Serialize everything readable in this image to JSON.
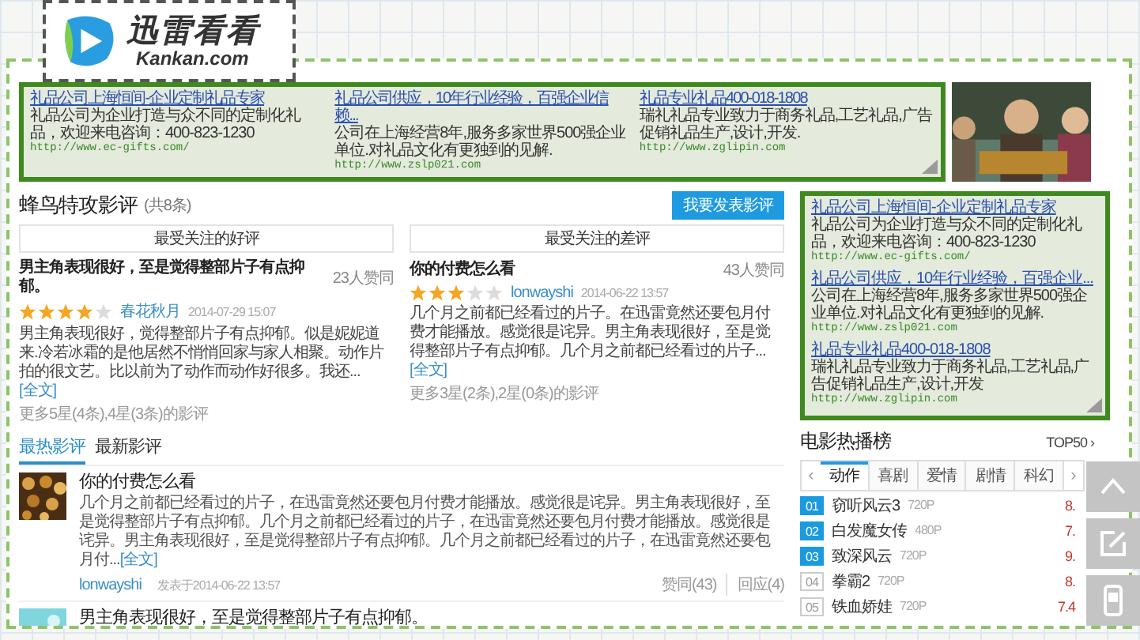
{
  "logo": {
    "name": "迅雷看看",
    "domain": "Kankan.com"
  },
  "top_ads": [
    {
      "title": "礼品公司上海恒间-企业定制礼品专家",
      "description": "礼品公司为企业打造与众不同的定制化礼品，欢迎来电咨询：400-823-1230",
      "url": "http://www.ec-gifts.com/"
    },
    {
      "title": "礼品公司供应，10年行业经验，百强企业信赖...",
      "description": "公司在上海经营8年,服务多家世界500强企业单位.对礼品文化有更独到的见解.",
      "url": "http://www.zslp021.com"
    },
    {
      "title": "礼品专业礼品400-018-1808",
      "description": "瑞礼礼品专业致力于商务礼品,工艺礼品,广告促销礼品生产,设计,开发.",
      "url": "http://www.zglipin.com"
    }
  ],
  "reviews": {
    "title": "蜂鸟特攻影评",
    "count": "(共8条)",
    "write_button": "我要发表影评",
    "columns": [
      {
        "heading": "最受关注的好评",
        "title": "男主角表现很好，至是觉得整部片子有点抑郁。",
        "votes": "23人赞同",
        "stars": 4,
        "author": "春花秋月",
        "date": "2014-07-29 15:07",
        "body": "男主角表现很好，觉得整部片子有点抑郁。似是妮妮道来.冷若冰霜的是他居然不悄悄回家与家人相聚。动作片拍的很文艺。比以前为了动作而动作好很多。我还...",
        "full_link": "[全文]",
        "more": "更多5星(4条),4星(3条)的影评"
      },
      {
        "heading": "最受关注的差评",
        "title": "你的付费怎么看",
        "votes": "43人赞同",
        "stars": 3,
        "author": "lonwayshi",
        "date": "2014-06-22 13:57",
        "body": "几个月之前都已经看过的片子。在迅雷竟然还要包月付费才能播放。感觉很是诧异。男主角表现很好，至是觉得整部片子有点抑郁。几个月之前都已经看过的片子...",
        "full_link": "[全文]",
        "more": "更多3星(2条),2星(0条)的影评"
      }
    ]
  },
  "feed": {
    "tabs": [
      {
        "label": "最热影评",
        "selected": true
      },
      {
        "label": "最新影评",
        "selected": false
      }
    ],
    "items": [
      {
        "title": "你的付费怎么看",
        "body": "几个月之前都已经看过的片子，在迅雷竟然还要包月付费才能播放。感觉很是诧异。男主角表现很好，至是觉得整部片子有点抑郁。几个月之前都已经看过的片子，在迅雷竟然还要包月付费才能播放。感觉很是诧异。男主角表现很好，至是觉得整部片子有点抑郁。几个月之前都已经看过的片子，在迅雷竟然还要包月付...",
        "full_link": "[全文]",
        "author": "lonwayshi",
        "date": "发表于2014-06-22 13:57",
        "likes": "赞同(43)",
        "replies": "回应(4)"
      },
      {
        "title": "男主角表现很好，至是觉得整部片子有点抑郁。"
      }
    ]
  },
  "sidebar_ads": [
    {
      "title": "礼品公司上海恒间-企业定制礼品专家",
      "description": "礼品公司为企业打造与众不同的定制化礼品，欢迎来电咨询：400-823-1230",
      "url": "http://www.ec-gifts.com/"
    },
    {
      "title": "礼品公司供应，10年行业经验，百强企业...",
      "description": "公司在上海经营8年,服务多家世界500强企业单位.对礼品文化有更独到的见解.",
      "url": "http://www.zslp021.com"
    },
    {
      "title": "礼品专业礼品400-018-1808",
      "description": "瑞礼礼品专业致力于商务礼品,工艺礼品,广告促销礼品生产,设计,开发",
      "url": "http://www.zglipin.com"
    }
  ],
  "hot_list": {
    "title": "电影热播榜",
    "more": "TOP50 ›",
    "prev": "‹",
    "next": "›",
    "tabs": [
      {
        "label": "动作",
        "selected": true
      },
      {
        "label": "喜剧",
        "selected": false
      },
      {
        "label": "爱情",
        "selected": false
      },
      {
        "label": "剧情",
        "selected": false
      },
      {
        "label": "科幻",
        "selected": false
      }
    ],
    "rows": [
      {
        "rank": "01",
        "title": "窃听风云3",
        "quality": "720P",
        "score": "8.",
        "highlight": true
      },
      {
        "rank": "02",
        "title": "白发魔女传",
        "quality": "480P",
        "score": "7.",
        "highlight": true
      },
      {
        "rank": "03",
        "title": "致深风云",
        "quality": "720P",
        "score": "9.",
        "highlight": true
      },
      {
        "rank": "04",
        "title": "拳霸2",
        "quality": "720P",
        "score": "8.",
        "highlight": false
      },
      {
        "rank": "05",
        "title": "铁血娇娃",
        "quality": "720P",
        "score": "7.4",
        "highlight": false
      }
    ]
  }
}
